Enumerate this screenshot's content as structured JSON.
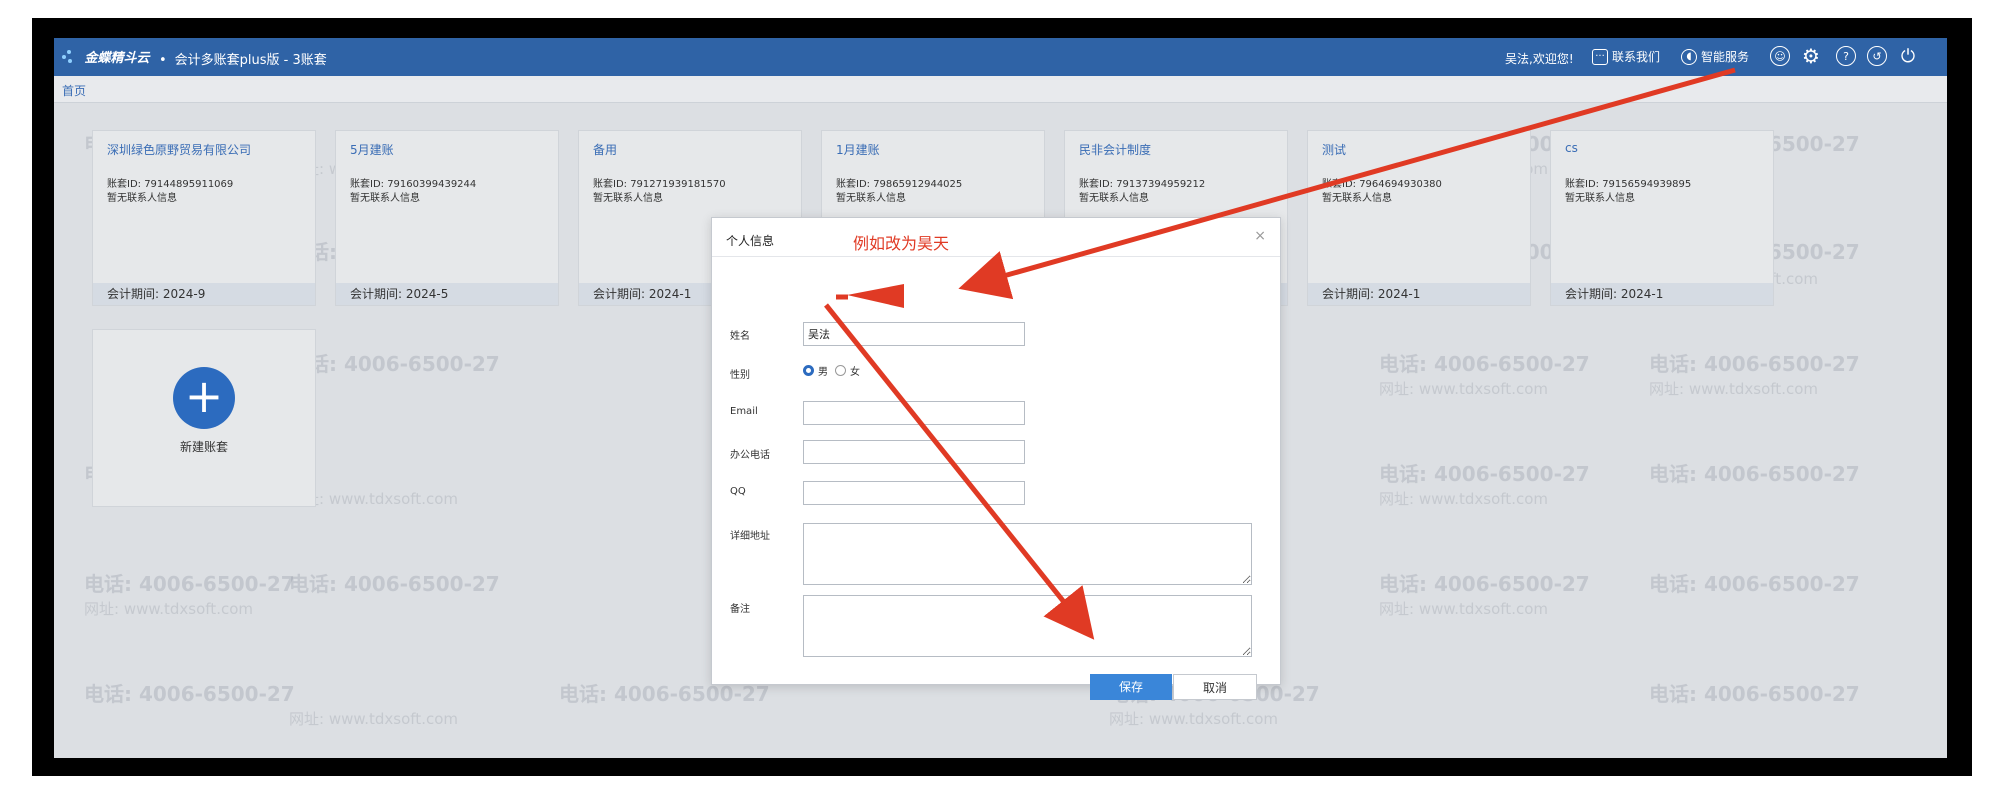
{
  "header": {
    "logo_text": "金蝶精斗云",
    "app_title": "会计多账套plus版 - 3账套",
    "welcome": "吴法,欢迎您!",
    "contact_us": "联系我们",
    "smart_service": "智能服务"
  },
  "breadcrumb": {
    "home": "首页"
  },
  "cards": [
    {
      "name": "深圳绿色原野贸易有限公司",
      "account_id": "账套ID: 79144895911069",
      "contact": "暂无联系人信息",
      "period": "会计期间: 2024-9"
    },
    {
      "name": "5月建账",
      "account_id": "账套ID: 79160399439244",
      "contact": "暂无联系人信息",
      "period": "会计期间: 2024-5"
    },
    {
      "name": "备用",
      "account_id": "账套ID: 791271939181570",
      "contact": "暂无联系人信息",
      "period": "会计期间: 2024-1"
    },
    {
      "name": "1月建账",
      "account_id": "账套ID: 79865912944025",
      "contact": "暂无联系人信息",
      "period": ""
    },
    {
      "name": "民非会计制度",
      "account_id": "账套ID: 79137394959212",
      "contact": "暂无联系人信息",
      "period": ""
    },
    {
      "name": "测试",
      "account_id": "账套ID: 7964694930380",
      "contact": "暂无联系人信息",
      "period": "会计期间: 2024-1"
    },
    {
      "name": "cs",
      "account_id": "账套ID: 79156594939895",
      "contact": "暂无联系人信息",
      "period": "会计期间: 2024-1"
    }
  ],
  "new_account": {
    "label": "新建账套"
  },
  "watermark": {
    "phone": "电话: 4006-6500-27",
    "site": "网址: www.tdxsoft.com"
  },
  "dialog": {
    "title": "个人信息",
    "close": "×",
    "fields": {
      "name_label": "姓名",
      "name_value": "吴法",
      "gender_label": "性别",
      "gender_male": "男",
      "gender_female": "女",
      "email_label": "Email",
      "office_phone_label": "办公电话",
      "qq_label": "QQ",
      "address_label": "详细地址",
      "remark_label": "备注"
    },
    "save": "保存",
    "cancel": "取消"
  },
  "annotation": {
    "text": "例如改为昊天",
    "color": "#e03a24"
  },
  "colors": {
    "header": "#2f63a6",
    "accent": "#3a86d9",
    "annotation": "#e03a24"
  }
}
